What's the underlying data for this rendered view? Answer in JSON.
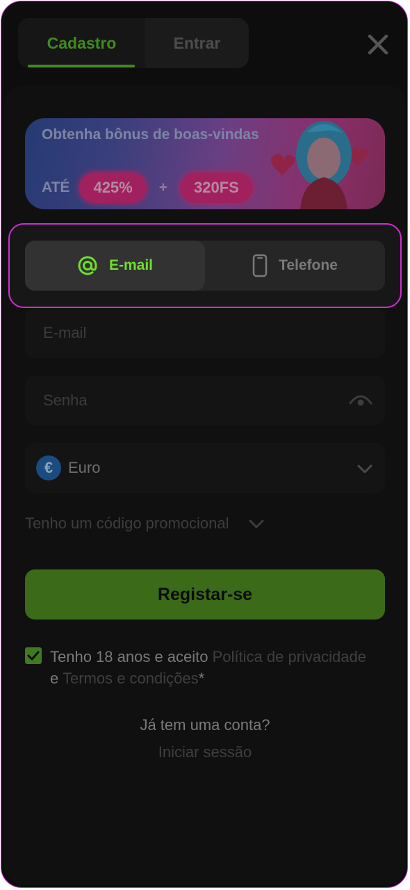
{
  "tabs": {
    "register_label": "Cadastro",
    "login_label": "Entrar",
    "active": "Cadastro"
  },
  "banner": {
    "title": "Obtenha bônus de boas-vindas",
    "up_to": "ATÉ",
    "bonus_percent": "425%",
    "plus": "+",
    "free_spins": "320FS"
  },
  "method": {
    "email_label": "E-mail",
    "phone_label": "Telefone",
    "selected": "E-mail"
  },
  "form": {
    "email_placeholder": "E-mail",
    "password_placeholder": "Senha",
    "currency": "Euro",
    "currency_symbol": "€",
    "promo_label": "Tenho um código promocional",
    "submit_label": "Registar-se"
  },
  "terms": {
    "checked": true,
    "prefix": "Tenho 18 anos e aceito ",
    "privacy": "Política de privacidade",
    "and": " e ",
    "conditions": "Termos e condições",
    "asterisk": "*"
  },
  "footer": {
    "question": "Já tem uma conta?",
    "login_link": "Iniciar sessão"
  },
  "colors": {
    "accent": "#6fde2f",
    "brand_green": "#3b6a19",
    "highlight": "#d42bd4",
    "bonus_pill": "#a1215e"
  }
}
